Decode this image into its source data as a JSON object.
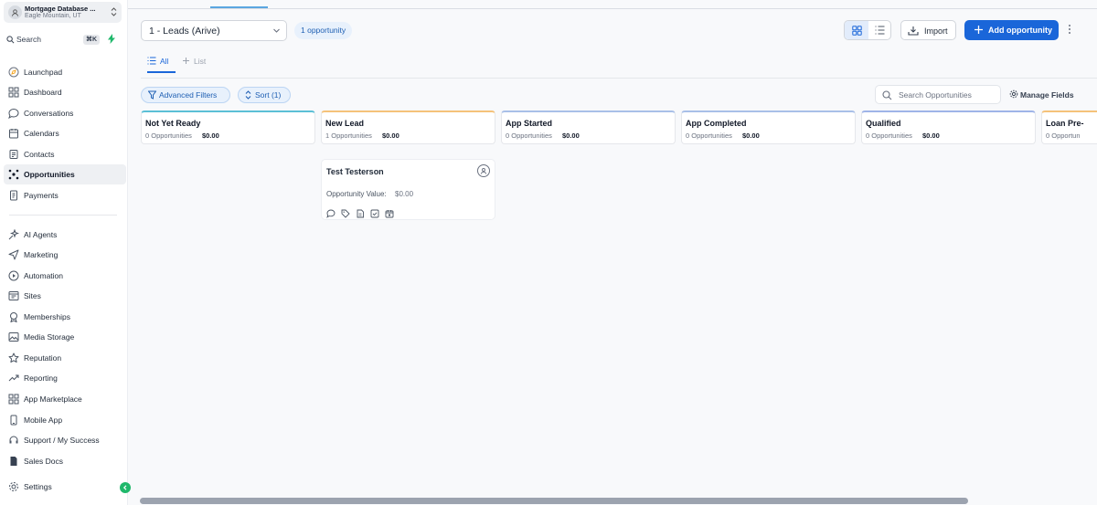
{
  "location": {
    "name": "Mortgage Database ...",
    "sub": "Eagle Mountain, UT"
  },
  "search": {
    "label": "Search",
    "shortcut": "⌘K"
  },
  "nav": {
    "items": [
      {
        "label": "Launchpad",
        "icon": "rocket-icon"
      },
      {
        "label": "Dashboard",
        "icon": "grid-icon"
      },
      {
        "label": "Conversations",
        "icon": "chat-icon"
      },
      {
        "label": "Calendars",
        "icon": "calendar-icon"
      },
      {
        "label": "Contacts",
        "icon": "contacts-icon"
      },
      {
        "label": "Opportunities",
        "icon": "opportunities-icon",
        "active": true
      },
      {
        "label": "Payments",
        "icon": "payments-icon"
      },
      {
        "label": "AI Agents",
        "icon": "sparkle-icon"
      },
      {
        "label": "Marketing",
        "icon": "send-icon"
      },
      {
        "label": "Automation",
        "icon": "automation-icon"
      },
      {
        "label": "Sites",
        "icon": "sites-icon"
      },
      {
        "label": "Memberships",
        "icon": "badge-icon"
      },
      {
        "label": "Media Storage",
        "icon": "image-icon"
      },
      {
        "label": "Reputation",
        "icon": "star-icon"
      },
      {
        "label": "Reporting",
        "icon": "trend-icon"
      },
      {
        "label": "App Marketplace",
        "icon": "apps-icon"
      },
      {
        "label": "Mobile App",
        "icon": "phone-icon"
      },
      {
        "label": "Support / My Success",
        "icon": "headset-icon"
      },
      {
        "label": "Sales Docs",
        "icon": "document-icon"
      },
      {
        "label": "Settings",
        "icon": "gear-icon"
      }
    ]
  },
  "toolbar": {
    "pipeline": "1 - Leads (Arive)",
    "count_pill": "1 opportunity",
    "import_label": "Import",
    "add_label": "Add opportunity"
  },
  "tabs": {
    "all": "All",
    "list": "List"
  },
  "filters": {
    "advanced_label": "Advanced Filters",
    "sort_label": "Sort (1)",
    "search_placeholder": "Search Opportunities",
    "manage_fields_label": "Manage Fields"
  },
  "columns": [
    {
      "name": "Not Yet Ready",
      "count": "0 Opportunities",
      "amount": "$0.00",
      "color": "#5bc0d6"
    },
    {
      "name": "New Lead",
      "count": "1 Opportunities",
      "amount": "$0.00",
      "color": "#f5c27a"
    },
    {
      "name": "App Started",
      "count": "0 Opportunities",
      "amount": "$0.00",
      "color": "#a9c0e8"
    },
    {
      "name": "App Completed",
      "count": "0 Opportunities",
      "amount": "$0.00",
      "color": "#a9c0e8"
    },
    {
      "name": "Qualified",
      "count": "0 Opportunities",
      "amount": "$0.00",
      "color": "#9fb4e8"
    },
    {
      "name": "Loan Pre-",
      "count": "0 Opportun",
      "amount": "",
      "color": "#f5c27a"
    }
  ],
  "card": {
    "title": "Test Testerson",
    "value_label": "Opportunity Value:",
    "value": "$0.00"
  },
  "colors": {
    "accent": "#1a66d9",
    "active_green": "#1fb86b"
  }
}
